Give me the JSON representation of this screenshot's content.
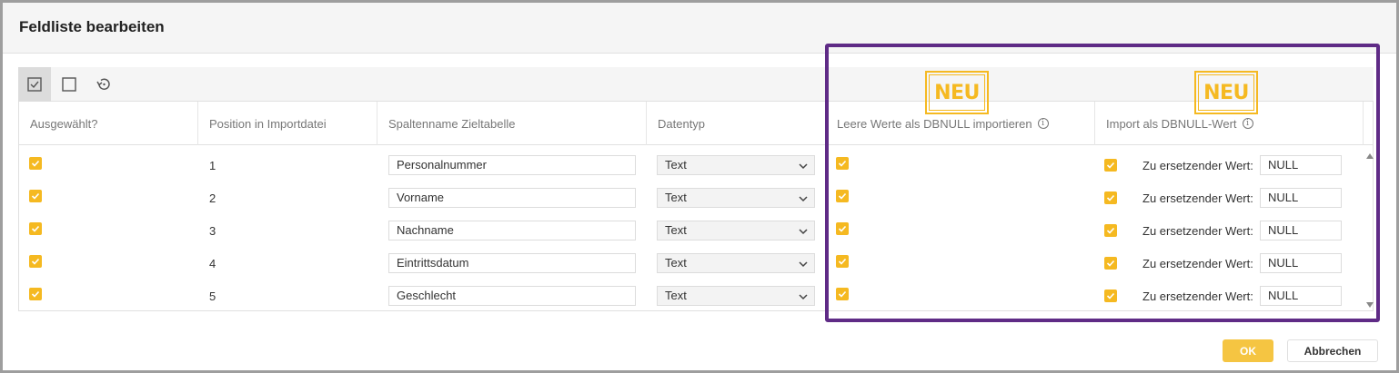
{
  "dialog": {
    "title": "Feldliste bearbeiten"
  },
  "toolbar": {
    "buttons": [
      {
        "icon": "select-all-checkbox-icon",
        "active": true
      },
      {
        "icon": "deselect-all-checkbox-icon",
        "active": false
      },
      {
        "icon": "reset-icon",
        "active": false
      }
    ]
  },
  "columns": {
    "selected": "Ausgewählt?",
    "position": "Position in Importdatei",
    "target_column": "Spaltenname Zieltabelle",
    "datatype": "Datentyp",
    "empty_as_null": "Leere Werte als DBNULL importieren",
    "import_null_value": "Import als DBNULL-Wert"
  },
  "info_glyph": "i",
  "rows": [
    {
      "selected": true,
      "position": "1",
      "target_column": "Personalnummer",
      "datatype": "Text",
      "empty_as_null": true,
      "use_null_value": true,
      "replace_label": "Zu ersetzender Wert:",
      "replace_value": "NULL"
    },
    {
      "selected": true,
      "position": "2",
      "target_column": "Vorname",
      "datatype": "Text",
      "empty_as_null": true,
      "use_null_value": true,
      "replace_label": "Zu ersetzender Wert:",
      "replace_value": "NULL"
    },
    {
      "selected": true,
      "position": "3",
      "target_column": "Nachname",
      "datatype": "Text",
      "empty_as_null": true,
      "use_null_value": true,
      "replace_label": "Zu ersetzender Wert:",
      "replace_value": "NULL"
    },
    {
      "selected": true,
      "position": "4",
      "target_column": "Eintrittsdatum",
      "datatype": "Text",
      "empty_as_null": true,
      "use_null_value": true,
      "replace_label": "Zu ersetzender Wert:",
      "replace_value": "NULL"
    },
    {
      "selected": true,
      "position": "5",
      "target_column": "Geschlecht",
      "datatype": "Text",
      "empty_as_null": true,
      "use_null_value": true,
      "replace_label": "Zu ersetzender Wert:",
      "replace_value": "NULL"
    }
  ],
  "badges": {
    "new_label": "NEU"
  },
  "buttons": {
    "ok": "OK",
    "cancel": "Abbrechen"
  },
  "colors": {
    "accent": "#f5b921",
    "highlight_frame": "#5f2b86"
  }
}
